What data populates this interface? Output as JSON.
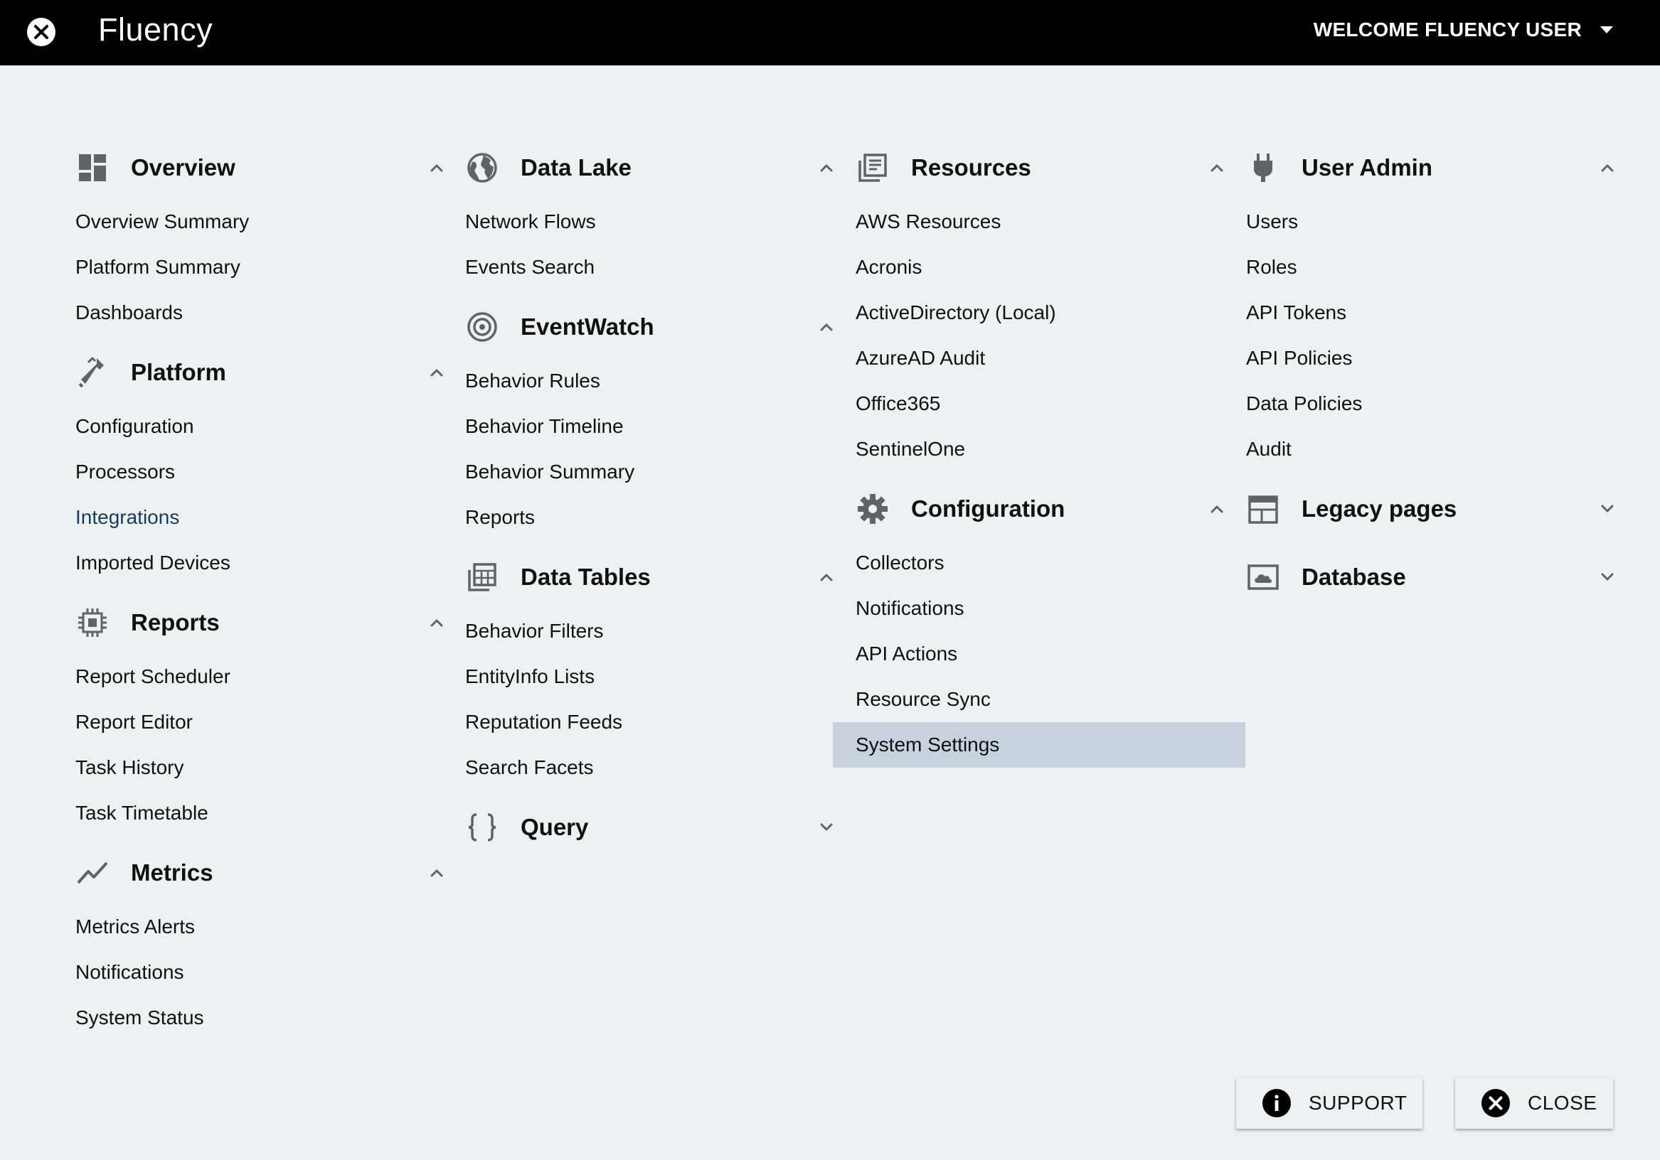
{
  "app": {
    "title": "Fluency",
    "welcome": "WELCOME FLUENCY USER"
  },
  "columns": [
    {
      "sections": [
        {
          "title": "Overview",
          "icon": "dashboard-icon",
          "expanded": true,
          "items": [
            "Overview Summary",
            "Platform Summary",
            "Dashboards"
          ]
        },
        {
          "title": "Platform",
          "icon": "tools-icon",
          "expanded": true,
          "items": [
            "Configuration",
            "Processors",
            "Integrations",
            "Imported Devices"
          ]
        },
        {
          "title": "Reports",
          "icon": "chip-icon",
          "expanded": true,
          "items": [
            "Report Scheduler",
            "Report Editor",
            "Task History",
            "Task Timetable"
          ]
        },
        {
          "title": "Metrics",
          "icon": "trend-icon",
          "expanded": true,
          "items": [
            "Metrics Alerts",
            "Notifications",
            "System Status"
          ]
        }
      ]
    },
    {
      "sections": [
        {
          "title": "Data Lake",
          "icon": "globe-icon",
          "expanded": true,
          "items": [
            "Network Flows",
            "Events Search"
          ]
        },
        {
          "title": "EventWatch",
          "icon": "target-icon",
          "expanded": true,
          "items": [
            "Behavior Rules",
            "Behavior Timeline",
            "Behavior Summary",
            "Reports"
          ]
        },
        {
          "title": "Data Tables",
          "icon": "table-icon",
          "expanded": true,
          "items": [
            "Behavior Filters",
            "EntityInfo Lists",
            "Reputation Feeds",
            "Search Facets"
          ]
        },
        {
          "title": "Query",
          "icon": "braces-icon",
          "expanded": false,
          "items": []
        }
      ]
    },
    {
      "sections": [
        {
          "title": "Resources",
          "icon": "library-icon",
          "expanded": true,
          "items": [
            "AWS Resources",
            "Acronis",
            "ActiveDirectory (Local)",
            "AzureAD Audit",
            "Office365",
            "SentinelOne"
          ]
        },
        {
          "title": "Configuration",
          "icon": "gear-icon",
          "expanded": true,
          "items": [
            "Collectors",
            "Notifications",
            "API Actions",
            "Resource Sync",
            "System Settings"
          ]
        }
      ]
    },
    {
      "sections": [
        {
          "title": "User Admin",
          "icon": "plug-icon",
          "expanded": true,
          "items": [
            "Users",
            "Roles",
            "API Tokens",
            "API Policies",
            "Data Policies",
            "Audit"
          ]
        },
        {
          "title": "Legacy pages",
          "icon": "calendar-icon",
          "expanded": false,
          "items": []
        },
        {
          "title": "Database",
          "icon": "cloud-box-icon",
          "expanded": false,
          "items": []
        }
      ]
    }
  ],
  "highlight": {
    "link_item": "Integrations",
    "selected_item": "System Settings"
  },
  "footer": {
    "support_label": "SUPPORT",
    "close_label": "CLOSE"
  },
  "colors": {
    "topbar": "#000000",
    "background": "#edf1f2",
    "selected": "#c6d2dc",
    "link": "#173c5e",
    "icon": "#5f6368"
  }
}
